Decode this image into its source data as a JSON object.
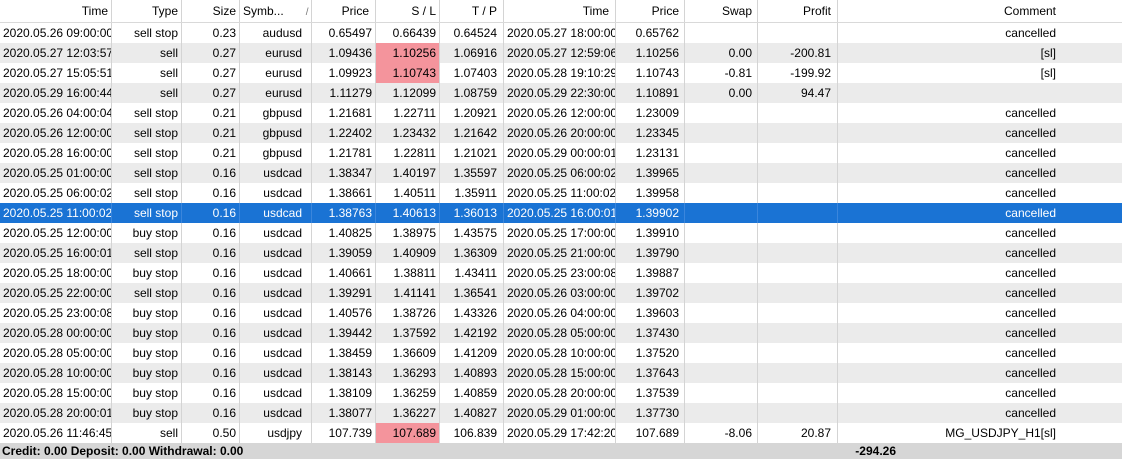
{
  "columns": [
    "Time",
    "Type",
    "Size",
    "Symb...",
    "Price",
    "S / L",
    "T / P",
    "Time",
    "Price",
    "Swap",
    "Profit",
    "Comment"
  ],
  "sort_indicator": "/",
  "rows": [
    {
      "time": "2020.05.26 09:00:00",
      "type": "sell stop",
      "size": "0.23",
      "symbol": "audusd",
      "price": "0.65497",
      "sl": "0.66439",
      "tp": "0.64524",
      "close_time": "2020.05.27 18:00:00",
      "close_price": "0.65762",
      "swap": "",
      "profit": "",
      "comment": "cancelled",
      "sl_hit": false
    },
    {
      "time": "2020.05.27 12:03:57",
      "type": "sell",
      "size": "0.27",
      "symbol": "eurusd",
      "price": "1.09436",
      "sl": "1.10256",
      "tp": "1.06916",
      "close_time": "2020.05.27 12:59:06",
      "close_price": "1.10256",
      "swap": "0.00",
      "profit": "-200.81",
      "comment": "[sl]",
      "sl_hit": true
    },
    {
      "time": "2020.05.27 15:05:51",
      "type": "sell",
      "size": "0.27",
      "symbol": "eurusd",
      "price": "1.09923",
      "sl": "1.10743",
      "tp": "1.07403",
      "close_time": "2020.05.28 19:10:29",
      "close_price": "1.10743",
      "swap": "-0.81",
      "profit": "-199.92",
      "comment": "[sl]",
      "sl_hit": true
    },
    {
      "time": "2020.05.29 16:00:44",
      "type": "sell",
      "size": "0.27",
      "symbol": "eurusd",
      "price": "1.11279",
      "sl": "1.12099",
      "tp": "1.08759",
      "close_time": "2020.05.29 22:30:00",
      "close_price": "1.10891",
      "swap": "0.00",
      "profit": "94.47",
      "comment": "",
      "sl_hit": false
    },
    {
      "time": "2020.05.26 04:00:04",
      "type": "sell stop",
      "size": "0.21",
      "symbol": "gbpusd",
      "price": "1.21681",
      "sl": "1.22711",
      "tp": "1.20921",
      "close_time": "2020.05.26 12:00:00",
      "close_price": "1.23009",
      "swap": "",
      "profit": "",
      "comment": "cancelled",
      "sl_hit": false
    },
    {
      "time": "2020.05.26 12:00:00",
      "type": "sell stop",
      "size": "0.21",
      "symbol": "gbpusd",
      "price": "1.22402",
      "sl": "1.23432",
      "tp": "1.21642",
      "close_time": "2020.05.26 20:00:00",
      "close_price": "1.23345",
      "swap": "",
      "profit": "",
      "comment": "cancelled",
      "sl_hit": false
    },
    {
      "time": "2020.05.28 16:00:00",
      "type": "sell stop",
      "size": "0.21",
      "symbol": "gbpusd",
      "price": "1.21781",
      "sl": "1.22811",
      "tp": "1.21021",
      "close_time": "2020.05.29 00:00:01",
      "close_price": "1.23131",
      "swap": "",
      "profit": "",
      "comment": "cancelled",
      "sl_hit": false
    },
    {
      "time": "2020.05.25 01:00:00",
      "type": "sell stop",
      "size": "0.16",
      "symbol": "usdcad",
      "price": "1.38347",
      "sl": "1.40197",
      "tp": "1.35597",
      "close_time": "2020.05.25 06:00:02",
      "close_price": "1.39965",
      "swap": "",
      "profit": "",
      "comment": "cancelled",
      "sl_hit": false
    },
    {
      "time": "2020.05.25 06:00:02",
      "type": "sell stop",
      "size": "0.16",
      "symbol": "usdcad",
      "price": "1.38661",
      "sl": "1.40511",
      "tp": "1.35911",
      "close_time": "2020.05.25 11:00:02",
      "close_price": "1.39958",
      "swap": "",
      "profit": "",
      "comment": "cancelled",
      "sl_hit": false
    },
    {
      "time": "2020.05.25 11:00:02",
      "type": "sell stop",
      "size": "0.16",
      "symbol": "usdcad",
      "price": "1.38763",
      "sl": "1.40613",
      "tp": "1.36013",
      "close_time": "2020.05.25 16:00:01",
      "close_price": "1.39902",
      "swap": "",
      "profit": "",
      "comment": "cancelled",
      "sl_hit": false,
      "selected": true
    },
    {
      "time": "2020.05.25 12:00:00",
      "type": "buy stop",
      "size": "0.16",
      "symbol": "usdcad",
      "price": "1.40825",
      "sl": "1.38975",
      "tp": "1.43575",
      "close_time": "2020.05.25 17:00:00",
      "close_price": "1.39910",
      "swap": "",
      "profit": "",
      "comment": "cancelled",
      "sl_hit": false
    },
    {
      "time": "2020.05.25 16:00:01",
      "type": "sell stop",
      "size": "0.16",
      "symbol": "usdcad",
      "price": "1.39059",
      "sl": "1.40909",
      "tp": "1.36309",
      "close_time": "2020.05.25 21:00:00",
      "close_price": "1.39790",
      "swap": "",
      "profit": "",
      "comment": "cancelled",
      "sl_hit": false
    },
    {
      "time": "2020.05.25 18:00:00",
      "type": "buy stop",
      "size": "0.16",
      "symbol": "usdcad",
      "price": "1.40661",
      "sl": "1.38811",
      "tp": "1.43411",
      "close_time": "2020.05.25 23:00:08",
      "close_price": "1.39887",
      "swap": "",
      "profit": "",
      "comment": "cancelled",
      "sl_hit": false
    },
    {
      "time": "2020.05.25 22:00:00",
      "type": "sell stop",
      "size": "0.16",
      "symbol": "usdcad",
      "price": "1.39291",
      "sl": "1.41141",
      "tp": "1.36541",
      "close_time": "2020.05.26 03:00:00",
      "close_price": "1.39702",
      "swap": "",
      "profit": "",
      "comment": "cancelled",
      "sl_hit": false
    },
    {
      "time": "2020.05.25 23:00:08",
      "type": "buy stop",
      "size": "0.16",
      "symbol": "usdcad",
      "price": "1.40576",
      "sl": "1.38726",
      "tp": "1.43326",
      "close_time": "2020.05.26 04:00:00",
      "close_price": "1.39603",
      "swap": "",
      "profit": "",
      "comment": "cancelled",
      "sl_hit": false
    },
    {
      "time": "2020.05.28 00:00:00",
      "type": "buy stop",
      "size": "0.16",
      "symbol": "usdcad",
      "price": "1.39442",
      "sl": "1.37592",
      "tp": "1.42192",
      "close_time": "2020.05.28 05:00:00",
      "close_price": "1.37430",
      "swap": "",
      "profit": "",
      "comment": "cancelled",
      "sl_hit": false
    },
    {
      "time": "2020.05.28 05:00:00",
      "type": "buy stop",
      "size": "0.16",
      "symbol": "usdcad",
      "price": "1.38459",
      "sl": "1.36609",
      "tp": "1.41209",
      "close_time": "2020.05.28 10:00:00",
      "close_price": "1.37520",
      "swap": "",
      "profit": "",
      "comment": "cancelled",
      "sl_hit": false
    },
    {
      "time": "2020.05.28 10:00:00",
      "type": "buy stop",
      "size": "0.16",
      "symbol": "usdcad",
      "price": "1.38143",
      "sl": "1.36293",
      "tp": "1.40893",
      "close_time": "2020.05.28 15:00:00",
      "close_price": "1.37643",
      "swap": "",
      "profit": "",
      "comment": "cancelled",
      "sl_hit": false
    },
    {
      "time": "2020.05.28 15:00:00",
      "type": "buy stop",
      "size": "0.16",
      "symbol": "usdcad",
      "price": "1.38109",
      "sl": "1.36259",
      "tp": "1.40859",
      "close_time": "2020.05.28 20:00:00",
      "close_price": "1.37539",
      "swap": "",
      "profit": "",
      "comment": "cancelled",
      "sl_hit": false
    },
    {
      "time": "2020.05.28 20:00:01",
      "type": "buy stop",
      "size": "0.16",
      "symbol": "usdcad",
      "price": "1.38077",
      "sl": "1.36227",
      "tp": "1.40827",
      "close_time": "2020.05.29 01:00:00",
      "close_price": "1.37730",
      "swap": "",
      "profit": "",
      "comment": "cancelled",
      "sl_hit": false
    },
    {
      "time": "2020.05.26 11:46:45",
      "type": "sell",
      "size": "0.50",
      "symbol": "usdjpy",
      "price": "107.739",
      "sl": "107.689",
      "tp": "106.839",
      "close_time": "2020.05.29 17:42:20",
      "close_price": "107.689",
      "swap": "-8.06",
      "profit": "20.87",
      "comment": "MG_USDJPY_H1[sl]",
      "sl_hit": true
    }
  ],
  "summary": {
    "text": "Credit: 0.00  Deposit: 0.00  Withdrawal: 0.00",
    "total": "-294.26"
  },
  "colors": {
    "selected_row": "#1a73d4",
    "alt_row": "#ebebeb",
    "sl_hit": "#f4949c"
  }
}
